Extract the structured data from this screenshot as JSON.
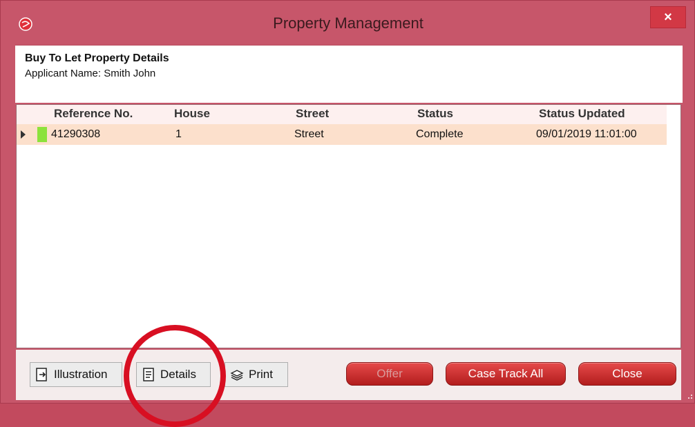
{
  "window": {
    "title": "Property Management",
    "close_glyph": "×"
  },
  "header": {
    "title": "Buy To Let Property Details",
    "applicant": "Applicant Name: Smith John"
  },
  "table": {
    "columns": [
      "Reference No.",
      "House",
      "Street",
      "Status",
      "Status Updated"
    ],
    "rows": [
      {
        "reference": "41290308",
        "house": "1",
        "street": "Street",
        "status": "Complete",
        "updated": "09/01/2019 11:01:00"
      }
    ]
  },
  "buttons": {
    "illustration": "Illustration",
    "details": "Details",
    "print": "Print",
    "offer": "Offer",
    "case_track_all": "Case Track All",
    "close": "Close"
  },
  "colors": {
    "frame": "#c7566a",
    "accent_red": "#d80f22",
    "row_highlight": "#fce0cc",
    "status_flag": "#8ce23c"
  },
  "icons": [
    "app-logo-icon",
    "illustration-icon",
    "details-icon",
    "print-icon"
  ]
}
